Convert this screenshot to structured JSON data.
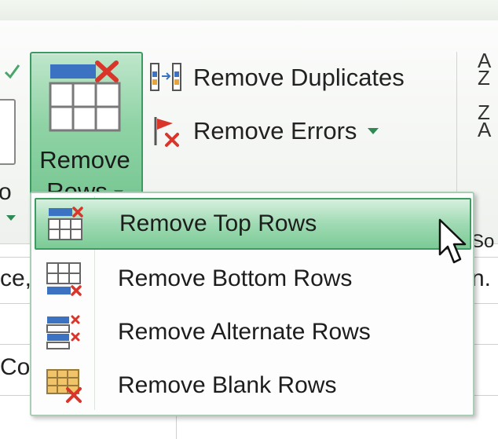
{
  "ribbon": {
    "left_partial_label": "o",
    "left_group_label": "",
    "remove_rows": {
      "line1": "Remove",
      "line2": "Rows"
    },
    "remove_duplicates": "Remove Duplicates",
    "remove_errors": "Remove Errors",
    "sort_group_label": "So"
  },
  "menu": {
    "items": [
      {
        "label": "Remove Top Rows",
        "icon": "remove-top-rows-icon",
        "highlighted": true
      },
      {
        "label": "Remove Bottom Rows",
        "icon": "remove-bottom-rows-icon"
      },
      {
        "label": "Remove Alternate Rows",
        "icon": "remove-alternate-rows-icon"
      },
      {
        "label": "Remove Blank Rows",
        "icon": "remove-blank-rows-icon"
      }
    ]
  },
  "sheet": {
    "formula_left": "ce,",
    "formula_right": "n.",
    "column_partial": "Co"
  },
  "colors": {
    "accent_green": "#74c590",
    "highlight_border": "#3e9c63",
    "delete_red": "#d9352b",
    "row_blue": "#3b73c2"
  }
}
